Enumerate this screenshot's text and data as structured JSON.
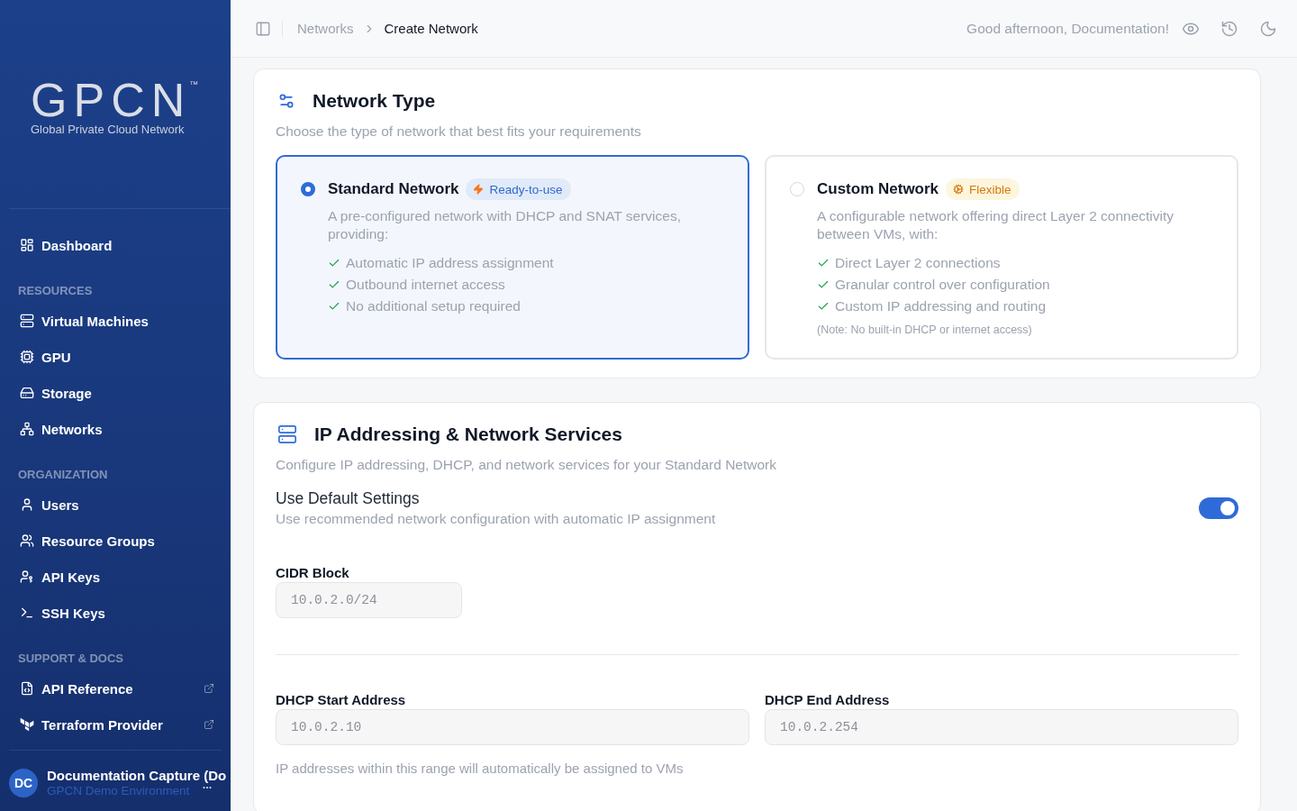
{
  "sidebar": {
    "logo": {
      "wordmark": "GPCN",
      "trademark": "™",
      "tagline": "Global Private Cloud Network"
    },
    "sections": [
      {
        "items": [
          {
            "label": "Dashboard",
            "selected": false
          }
        ]
      },
      {
        "title": "RESOURCES",
        "items": [
          {
            "label": "Virtual Machines",
            "selected": false
          },
          {
            "label": "GPU",
            "selected": false
          },
          {
            "label": "Storage",
            "selected": false
          },
          {
            "label": "Networks",
            "selected": false
          }
        ]
      },
      {
        "title": "ORGANIZATION",
        "items": [
          {
            "label": "Users",
            "selected": false
          },
          {
            "label": "Resource Groups",
            "selected": false
          },
          {
            "label": "API Keys",
            "selected": false
          },
          {
            "label": "SSH Keys",
            "selected": false
          }
        ]
      },
      {
        "title": "SUPPORT & DOCS",
        "items": [
          {
            "label": "API Reference",
            "selected": false,
            "external": true
          },
          {
            "label": "Terraform Provider",
            "selected": false,
            "external": true
          }
        ]
      }
    ],
    "user": {
      "initials": "DC",
      "name": "Documentation Capture (Do",
      "subtitle": "GPCN Demo Environment"
    }
  },
  "header": {
    "breadcrumb": [
      {
        "label": "Networks",
        "current": false
      },
      {
        "label": "Create Network",
        "current": true
      }
    ],
    "greeting": "Good afternoon, Documentation!"
  },
  "network_type": {
    "title": "Network Type",
    "subtitle": "Choose the type of network that best fits your requirements",
    "options": [
      {
        "title": "Standard Network",
        "badge": {
          "label": "Ready-to-use",
          "kind": "ready"
        },
        "selected": true,
        "description": "A pre-configured network with DHCP and SNAT services, providing:",
        "features": [
          "Automatic IP address assignment",
          "Outbound internet access",
          "No additional setup required"
        ]
      },
      {
        "title": "Custom Network",
        "badge": {
          "label": "Flexible",
          "kind": "flexible"
        },
        "selected": false,
        "description": "A configurable network offering direct Layer 2 connectivity between VMs, with:",
        "features": [
          "Direct Layer 2 connections",
          "Granular control over configuration",
          "Custom IP addressing and routing"
        ],
        "note": "(Note: No built-in DHCP or internet access)"
      }
    ]
  },
  "ip_services": {
    "title": "IP Addressing & Network Services",
    "subtitle": "Configure IP addressing, DHCP, and network services for your Standard Network",
    "default_settings": {
      "label": "Use Default Settings",
      "description": "Use recommended network configuration with automatic IP assignment",
      "on": true
    },
    "cidr": {
      "label": "CIDR Block",
      "value": "10.0.2.0/24",
      "disabled": true
    },
    "dhcp": [
      {
        "label": "DHCP Start Address",
        "value": "10.0.2.10",
        "disabled": true
      },
      {
        "label": "DHCP End Address",
        "value": "10.0.2.254",
        "disabled": true
      }
    ],
    "helper": "IP addresses within this range will automatically be assigned to VMs"
  }
}
